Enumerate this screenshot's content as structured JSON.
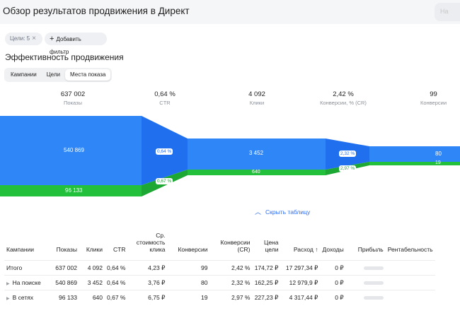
{
  "header": {
    "title": "Обзор результатов продвижения в Директ",
    "button_label": "На"
  },
  "filters": {
    "goals_chip": "Цели: 5",
    "add_filter": "Добавить фильтр"
  },
  "section": {
    "title": "Эффективность продвижения"
  },
  "tabs": [
    {
      "label": "Кампании",
      "active": false
    },
    {
      "label": "Цели",
      "active": false
    },
    {
      "label": "Места показа",
      "active": true
    }
  ],
  "metrics": [
    {
      "value": "637 002",
      "label": "Показы"
    },
    {
      "value": "0,64 %",
      "label": "CTR"
    },
    {
      "value": "4 092",
      "label": "Клики"
    },
    {
      "value": "2,42 %",
      "label": "Конверсии, % (CR)"
    },
    {
      "value": "99",
      "label": "Конверсии"
    }
  ],
  "funnel": {
    "search_impressions": "540 869",
    "network_impressions": "96 133",
    "search_ctr": "0,64 %",
    "network_ctr": "0,67 %",
    "search_clicks": "3 452",
    "network_clicks": "640",
    "search_cr": "2,32 %",
    "network_cr": "2,97 %",
    "search_conversions": "80",
    "network_conversions": "19",
    "colors": {
      "search": "#2f86f6",
      "network": "#22c03b",
      "search_dark": "#1f6fef"
    }
  },
  "table_toggle": "Скрыть таблицу",
  "table": {
    "headers": [
      "Кампании",
      "Показы",
      "Клики",
      "CTR",
      "Ср. стоимость клика",
      "Конверсии",
      "Конверсии (CR)",
      "Цена цели",
      "Расход ↑",
      "Доходы",
      "Прибыль",
      "Рентабельность"
    ],
    "rows": [
      {
        "name": "Итого",
        "impressions": "637 002",
        "clicks": "4 092",
        "ctr": "0,64 %",
        "cpc": "4,23 ₽",
        "conversions": "99",
        "cr": "2,42 %",
        "cpa": "174,72 ₽",
        "spend": "17 297,34 ₽",
        "revenue": "0 ₽"
      },
      {
        "name": "На поиске",
        "impressions": "540 869",
        "clicks": "3 452",
        "ctr": "0,64 %",
        "cpc": "3,76 ₽",
        "conversions": "80",
        "cr": "2,32 %",
        "cpa": "162,25 ₽",
        "spend": "12 979,9 ₽",
        "revenue": "0 ₽"
      },
      {
        "name": "В сетях",
        "impressions": "96 133",
        "clicks": "640",
        "ctr": "0,67 %",
        "cpc": "6,75 ₽",
        "conversions": "19",
        "cr": "2,97 %",
        "cpa": "227,23 ₽",
        "spend": "4 317,44 ₽",
        "revenue": "0 ₽"
      }
    ]
  }
}
